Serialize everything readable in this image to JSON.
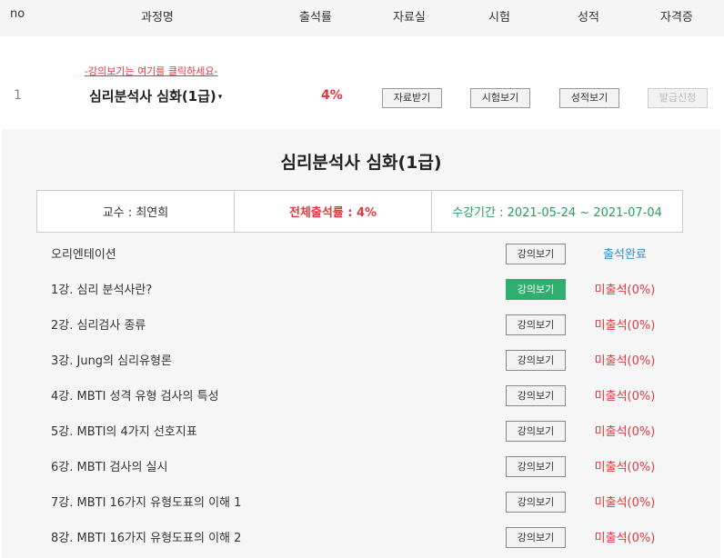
{
  "header": {
    "no": "no",
    "course": "과정명",
    "attendance": "출석률",
    "materials": "자료실",
    "exam": "시험",
    "grade": "성적",
    "certificate": "자격증"
  },
  "course": {
    "hint": "-강의보기는 여기를 클릭하세요-",
    "number": "1",
    "title": "심리분석사 심화(1급)",
    "caret": "▾",
    "rate": "4%",
    "download_label": "자료받기",
    "exam_label": "시험보기",
    "grade_label": "성적보기",
    "issue_label": "발급신청"
  },
  "detail": {
    "title": "심리분석사 심화(1급)",
    "professor": "교수 : 최연희",
    "total_rate": "전체출석률 : 4%",
    "period": "수강기간 : 2021-05-24 ~ 2021-07-04"
  },
  "lessons": [
    {
      "title": "오리엔테이션",
      "button": "강의보기",
      "status": "출석완료"
    },
    {
      "title": "1강. 심리 분석사란?",
      "button": "강의보기",
      "status": "미출석(0%)"
    },
    {
      "title": "2강. 심리검사 종류",
      "button": "강의보기",
      "status": "미출석(0%)"
    },
    {
      "title": "3강. Jung의 심리유형론",
      "button": "강의보기",
      "status": "미출석(0%)"
    },
    {
      "title": "4강. MBTI 성격 유형 검사의 특성",
      "button": "강의보기",
      "status": "미출석(0%)"
    },
    {
      "title": "5강. MBTI의 4가지 선호지표",
      "button": "강의보기",
      "status": "미출석(0%)"
    },
    {
      "title": "6강. MBTI 검사의 실시",
      "button": "강의보기",
      "status": "미출석(0%)"
    },
    {
      "title": "7강. MBTI 16가지 유형도표의 이해 1",
      "button": "강의보기",
      "status": "미출석(0%)"
    },
    {
      "title": "8강. MBTI 16가지 유형도표의 이해 2",
      "button": "강의보기",
      "status": "미출석(0%)"
    }
  ],
  "colors": {
    "accent_red": "#e0393e",
    "active_green": "#2eaf6f",
    "done_blue": "#2b8fc7",
    "period_green": "#2a9d5c"
  }
}
